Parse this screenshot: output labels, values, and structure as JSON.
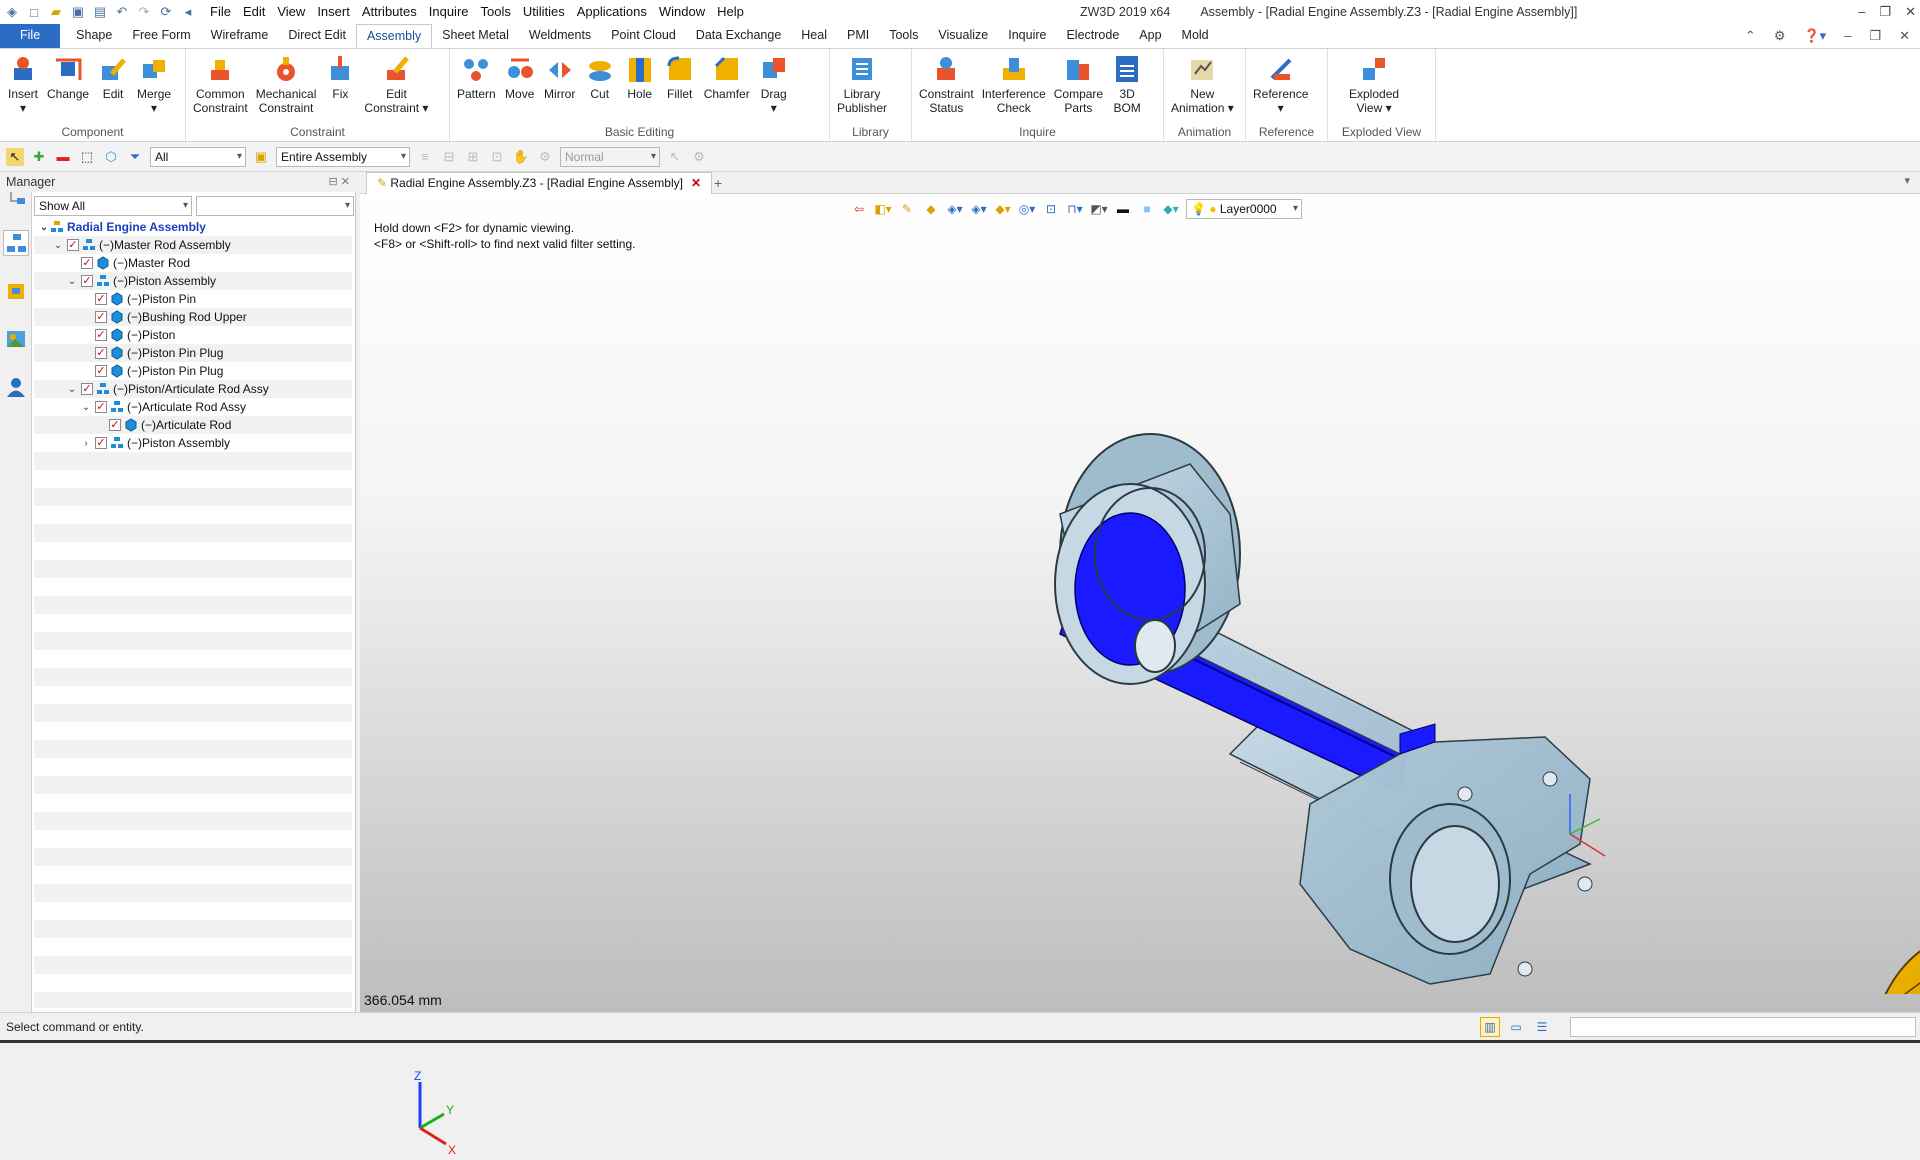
{
  "titlebar": {
    "app": "ZW3D 2019  x64",
    "doc_title": "Assembly - [Radial Engine Assembly.Z3 - [Radial Engine Assembly]]",
    "menus": [
      "File",
      "Edit",
      "View",
      "Insert",
      "Attributes",
      "Inquire",
      "Tools",
      "Utilities",
      "Applications",
      "Window",
      "Help"
    ]
  },
  "ribbon_tabs": [
    "File",
    "Shape",
    "Free Form",
    "Wireframe",
    "Direct Edit",
    "Assembly",
    "Sheet Metal",
    "Weldments",
    "Point Cloud",
    "Data Exchange",
    "Heal",
    "PMI",
    "Tools",
    "Visualize",
    "Inquire",
    "Electrode",
    "App",
    "Mold"
  ],
  "active_tab": "Assembly",
  "ribbon": {
    "component": {
      "name": "Component",
      "buttons": [
        "Insert",
        "Change",
        "Edit",
        "Merge"
      ]
    },
    "constraint": {
      "name": "Constraint",
      "buttons": [
        "Common\nConstraint",
        "Mechanical\nConstraint",
        "Fix",
        "Edit\nConstraint ▾"
      ]
    },
    "basic_editing": {
      "name": "Basic Editing",
      "buttons": [
        "Pattern",
        "Move",
        "Mirror",
        "Cut",
        "Hole",
        "Fillet",
        "Chamfer",
        "Drag"
      ]
    },
    "library": {
      "name": "Library",
      "buttons": [
        "Library\nPublisher"
      ]
    },
    "inquire": {
      "name": "Inquire",
      "buttons": [
        "Constraint\nStatus",
        "Interference\nCheck",
        "Compare\nParts",
        "3D\nBOM"
      ]
    },
    "animation": {
      "name": "Animation",
      "buttons": [
        "New\nAnimation ▾"
      ]
    },
    "reference": {
      "name": "Reference",
      "buttons": [
        "Reference"
      ]
    },
    "exploded": {
      "name": "Exploded View",
      "buttons": [
        "Exploded\nView  ▾"
      ]
    }
  },
  "filterbar": {
    "filter": "All",
    "scope": "Entire Assembly",
    "mode": "Normal"
  },
  "manager": {
    "title": "Manager",
    "show": "Show All",
    "tree": [
      {
        "label": "Radial Engine Assembly",
        "level": 0,
        "exp": "⌄",
        "checked": false,
        "icon": "assembly",
        "root": true
      },
      {
        "label": "(−)Master Rod Assembly",
        "level": 1,
        "exp": "⌄",
        "checked": true,
        "icon": "subassembly"
      },
      {
        "label": "(−)Master Rod",
        "level": 2,
        "exp": "",
        "checked": true,
        "icon": "part"
      },
      {
        "label": "(−)Piston Assembly",
        "level": 2,
        "exp": "⌄",
        "checked": true,
        "icon": "subassembly"
      },
      {
        "label": "(−)Piston Pin",
        "level": 3,
        "exp": "",
        "checked": true,
        "icon": "part"
      },
      {
        "label": "(−)Bushing Rod Upper",
        "level": 3,
        "exp": "",
        "checked": true,
        "icon": "part"
      },
      {
        "label": "(−)Piston",
        "level": 3,
        "exp": "",
        "checked": true,
        "icon": "part"
      },
      {
        "label": "(−)Piston Pin Plug",
        "level": 3,
        "exp": "",
        "checked": true,
        "icon": "part"
      },
      {
        "label": "(−)Piston Pin Plug",
        "level": 3,
        "exp": "",
        "checked": true,
        "icon": "part"
      },
      {
        "label": "(−)Piston/Articulate Rod Assy",
        "level": 2,
        "exp": "⌄",
        "checked": true,
        "icon": "subassembly"
      },
      {
        "label": "(−)Articulate Rod Assy",
        "level": 3,
        "exp": "⌄",
        "checked": true,
        "icon": "subassembly"
      },
      {
        "label": "(−)Articulate Rod",
        "level": 4,
        "exp": "",
        "checked": true,
        "icon": "part"
      },
      {
        "label": "(−)Piston Assembly",
        "level": 3,
        "exp": "›",
        "checked": true,
        "icon": "subassembly"
      }
    ]
  },
  "document": {
    "tab": "Radial Engine Assembly.Z3 - [Radial Engine Assembly]",
    "layer": "Layer0000",
    "hint1": "Hold down <F2> for dynamic viewing.",
    "hint2": "<F8> or <Shift-roll> to find next valid filter setting.",
    "scale": "366.054 mm",
    "axes": {
      "x": "X",
      "y": "Y",
      "z": "Z"
    }
  },
  "status": {
    "text": "Select command or entity."
  },
  "colors": {
    "accent": "#2b6cc4",
    "rod_highlight": "#1a1aff",
    "part_gray": "#a9c4d6",
    "piston_gold": "#e0a100"
  }
}
